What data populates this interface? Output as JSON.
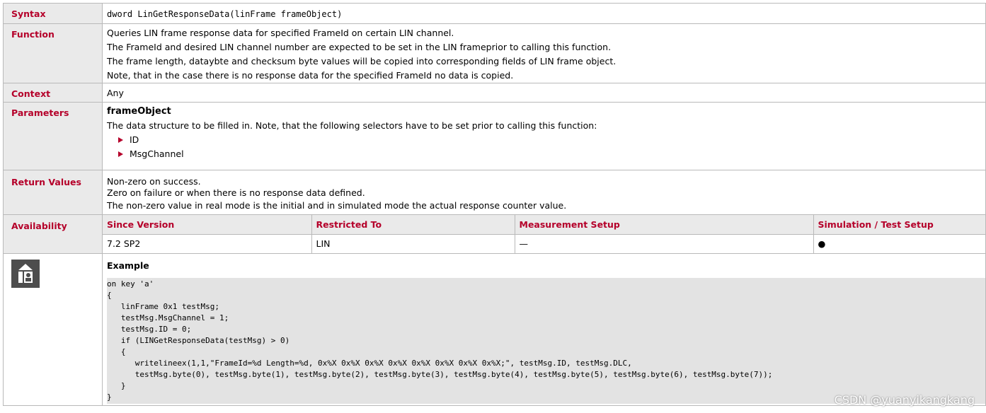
{
  "rows": {
    "syntax": {
      "label": "Syntax",
      "text": "dword LinGetResponseData(linFrame frameObject)"
    },
    "function": {
      "label": "Function",
      "lines": [
        "Queries LIN frame response data for specified FrameId on certain LIN channel.",
        "The FrameId and desired LIN channel number are expected to be set in the LIN frameprior to calling this function.",
        "The frame length, dataybte and checksum byte values will be copied into corresponding fields of LIN frame object.",
        "Note, that in the case there is no response data for the specified FrameId no data is copied."
      ]
    },
    "context": {
      "label": "Context",
      "text": "Any"
    },
    "parameters": {
      "label": "Parameters",
      "name": "frameObject",
      "description": "The data structure to be filled in. Note, that the following selectors have to be set prior to calling this function:",
      "selectors": [
        "ID",
        "MsgChannel"
      ]
    },
    "return_values": {
      "label": "Return Values",
      "lines": [
        "Non-zero on success.",
        "Zero on failure or when there is no response data defined.",
        "The non-zero value in real mode is the initial and in simulated mode the actual response counter value."
      ]
    },
    "availability": {
      "label": "Availability",
      "headers": [
        "Since Version",
        "Restricted To",
        "Measurement Setup",
        "Simulation / Test Setup"
      ],
      "values": [
        "7.2 SP2",
        "LIN",
        "—",
        "●"
      ]
    },
    "example": {
      "title": "Example",
      "icon": "example-icon",
      "code": "on key 'a'\n{\n   linFrame 0x1 testMsg;\n   testMsg.MsgChannel = 1;\n   testMsg.ID = 0;\n   if (LINGetResponseData(testMsg) > 0)\n   {\n      writelineex(1,1,\"FrameId=%d Length=%d, 0x%X 0x%X 0x%X 0x%X 0x%X 0x%X 0x%X 0x%X;\", testMsg.ID, testMsg.DLC,\n      testMsg.byte(0), testMsg.byte(1), testMsg.byte(2), testMsg.byte(3), testMsg.byte(4), testMsg.byte(5), testMsg.byte(6), testMsg.byte(7));\n   }\n}"
    }
  },
  "watermark": "CSDN @yuanyikangkang",
  "colors": {
    "label_text": "#b5002a",
    "label_bg": "#eaeaea",
    "code_bg": "#e3e3e3",
    "border": "#b9b9b9"
  }
}
